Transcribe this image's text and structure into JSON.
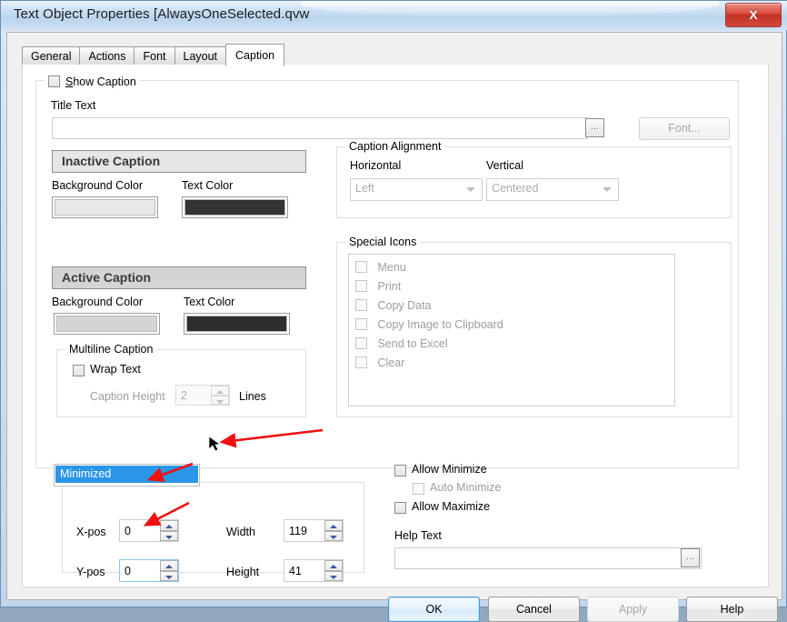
{
  "window": {
    "title": "Text Object Properties [AlwaysOneSelected.qvw",
    "close_label": "X"
  },
  "tabs": [
    {
      "label": "General",
      "active": false
    },
    {
      "label": "Actions",
      "active": false
    },
    {
      "label": "Font",
      "active": false
    },
    {
      "label": "Layout",
      "active": false
    },
    {
      "label": "Caption",
      "active": true
    }
  ],
  "caption_panel": {
    "show_caption": {
      "label": "Show Caption",
      "checked": false
    },
    "title_text": {
      "label": "Title Text",
      "value": "",
      "placeholder": "",
      "ellipsis_label": "..."
    },
    "font_button": {
      "label": "Font...",
      "enabled": false
    },
    "inactive": {
      "preview_label": "Inactive Caption",
      "preview_bg": "#e6e6e6",
      "preview_text_color": "#3a3a3a",
      "background_color_label": "Background Color",
      "background_color": "#e8e8e8",
      "text_color_label": "Text Color",
      "text_color": "#333333"
    },
    "active": {
      "preview_label": "Active Caption",
      "preview_bg": "#d4d4d4",
      "preview_text_color": "#3a3a3a",
      "background_color_label": "Background Color",
      "background_color": "#d4d4d4",
      "text_color_label": "Text Color",
      "text_color": "#2e2e2e"
    },
    "multiline": {
      "group_label": "Multiline Caption",
      "wrap_text": {
        "label": "Wrap Text",
        "checked": false
      },
      "caption_height_label": "Caption Height",
      "caption_height_value": "2",
      "lines_label": "Lines",
      "enabled": false
    },
    "alignment": {
      "group_label": "Caption Alignment",
      "horizontal_label": "Horizontal",
      "horizontal_value": "Left",
      "vertical_label": "Vertical",
      "vertical_value": "Centered",
      "enabled": false
    },
    "special_icons": {
      "group_label": "Special Icons",
      "items": [
        {
          "label": "Menu",
          "checked": false
        },
        {
          "label": "Print",
          "checked": false
        },
        {
          "label": "Copy Data",
          "checked": false
        },
        {
          "label": "Copy Image to Clipboard",
          "checked": false
        },
        {
          "label": "Send to Excel",
          "checked": false
        },
        {
          "label": "Clear",
          "checked": false
        }
      ]
    }
  },
  "position_panel": {
    "state_combo": {
      "selected": "Minimized",
      "highlight_color": "#2a96e8"
    },
    "x_pos": {
      "label": "X-pos",
      "value": "0"
    },
    "y_pos": {
      "label": "Y-pos",
      "value": "0"
    },
    "width": {
      "label": "Width",
      "value": "119"
    },
    "height": {
      "label": "Height",
      "value": "41"
    }
  },
  "options_panel": {
    "allow_minimize": {
      "label": "Allow Minimize",
      "checked": false
    },
    "auto_minimize": {
      "label": "Auto Minimize",
      "checked": false,
      "enabled": false
    },
    "allow_maximize": {
      "label": "Allow Maximize",
      "checked": false
    },
    "help_text": {
      "label": "Help Text",
      "value": "",
      "ellipsis_label": "..."
    }
  },
  "footer_buttons": [
    {
      "label": "OK",
      "enabled": true,
      "focused": true
    },
    {
      "label": "Cancel",
      "enabled": true,
      "focused": false
    },
    {
      "label": "Apply",
      "enabled": false,
      "focused": false
    },
    {
      "label": "Help",
      "enabled": true,
      "focused": false
    }
  ],
  "annotations": {
    "arrow_color": "#ee1111",
    "count": 3
  }
}
